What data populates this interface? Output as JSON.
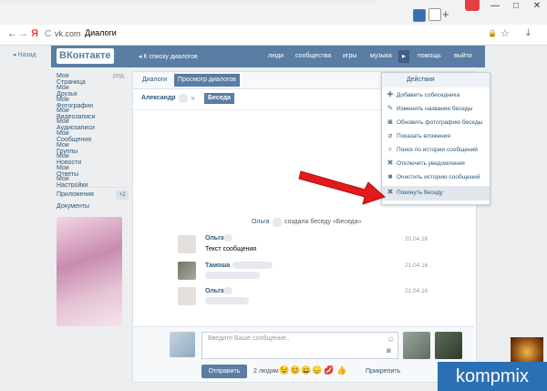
{
  "browser": {
    "new_tab_symbol": "+",
    "window_controls": [
      "—",
      "□",
      "✕"
    ],
    "back_glyph": "←",
    "forward_glyph": "→",
    "y_logo": "Я",
    "reload_glyph": "C",
    "url": "vk.com",
    "page_title": "Диалоги",
    "lock_glyph": "🔒",
    "star_glyph": "☆",
    "download_glyph": "⤓"
  },
  "vk": {
    "back_label": "Назад",
    "logo_text": "ВКонтакте",
    "back_to_dialogs": "К списку диалогов",
    "header_links": [
      "люди",
      "сообщества",
      "игры",
      "музыка",
      "помощь",
      "выйти"
    ],
    "more_glyph": "▸"
  },
  "nav": {
    "items": [
      {
        "label": "Моя Страница",
        "extra": "ред."
      },
      {
        "label": "Мои Друзья"
      },
      {
        "label": "Мои Фотографии"
      },
      {
        "label": "Мои Видеозаписи"
      },
      {
        "label": "Мои Аудиозаписи"
      },
      {
        "label": "Мои Сообщения"
      },
      {
        "label": "Мои Группы"
      },
      {
        "label": "Мои Новости"
      },
      {
        "label": "Мои Ответы"
      },
      {
        "label": "Мои Настройки"
      }
    ],
    "apps_label": "Приложения",
    "apps_badge": "+2",
    "docs_label": "Документы"
  },
  "dialog": {
    "tabs": [
      "Диалоги",
      "Просмотр диалогов"
    ],
    "participants": [
      "Александр",
      "Беседа"
    ],
    "remove_glyph": "×",
    "system_message_prefix": "Ольга",
    "system_message_suffix": "создала беседу «Беседа»",
    "messages": [
      {
        "author": "Ольга",
        "text": "Текст сообщения",
        "date": "20.04.16"
      },
      {
        "author": "Тамоша",
        "text": "",
        "date": "21.04.16"
      },
      {
        "author": "Ольга",
        "text": "",
        "date": "21.04.16"
      }
    ],
    "input_placeholder": "Введите Ваше сообщение..",
    "send_label": "Отправить",
    "people_count": "2 людям",
    "emoji": [
      "😉",
      "😊",
      "😀",
      "😞",
      "💋",
      "👍"
    ],
    "attach_label": "Прикрепить"
  },
  "menu": {
    "title": "Действия",
    "items": [
      {
        "icon": "add-user-icon",
        "glyph": "✚",
        "label": "Добавить собеседника"
      },
      {
        "icon": "pencil-icon",
        "glyph": "✎",
        "label": "Изменить название беседы"
      },
      {
        "icon": "camera-icon",
        "glyph": "◙",
        "label": "Обновить фотографию беседы"
      },
      {
        "icon": "paperclip-icon",
        "glyph": "⌀",
        "label": "Показать вложения"
      },
      {
        "icon": "search-icon",
        "glyph": "⌕",
        "label": "Поиск по истории сообщений"
      },
      {
        "icon": "mute-icon",
        "glyph": "✖",
        "label": "Отключить уведомления"
      },
      {
        "icon": "trash-icon",
        "glyph": "■",
        "label": "Очистить историю сообщений"
      },
      {
        "icon": "leave-icon",
        "glyph": "✖",
        "label": "Покинуть беседу"
      }
    ],
    "highlight_index": 7
  },
  "colors": {
    "vk_blue": "#597da3",
    "arrow_red": "#e3191c",
    "watermark_bg": "#2b6fb5"
  },
  "watermark": "kompmix"
}
